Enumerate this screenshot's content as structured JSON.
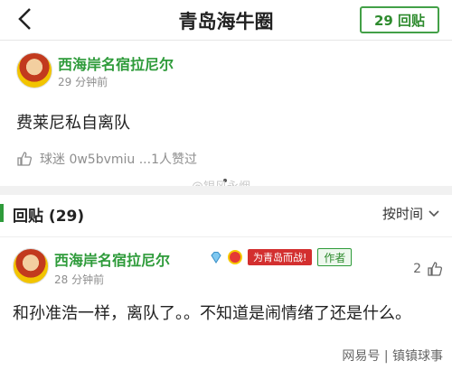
{
  "header": {
    "title": "青岛海牛圈",
    "reply_count_button": "29 回贴"
  },
  "post": {
    "author": "西海岸名宿拉尼尔",
    "time": "29 分钟前",
    "content": "费莱尼私自离队",
    "likes_text": "球迷 0w5bvmiu ...1人赞过"
  },
  "watermark_top": "@银风永烟",
  "replies": {
    "title": "回贴 (29)",
    "sort_label": "按时间"
  },
  "reply": {
    "author": "西海岸名宿拉尼尔",
    "time": "28 分钟前",
    "banner_text": "为青岛而战!",
    "author_tag": "作者",
    "likes": "2",
    "content": "和孙准浩一样，离队了。。不知道是闹情绪了还是什么。"
  },
  "footer_watermark": "网易号 | 镇镇球事"
}
